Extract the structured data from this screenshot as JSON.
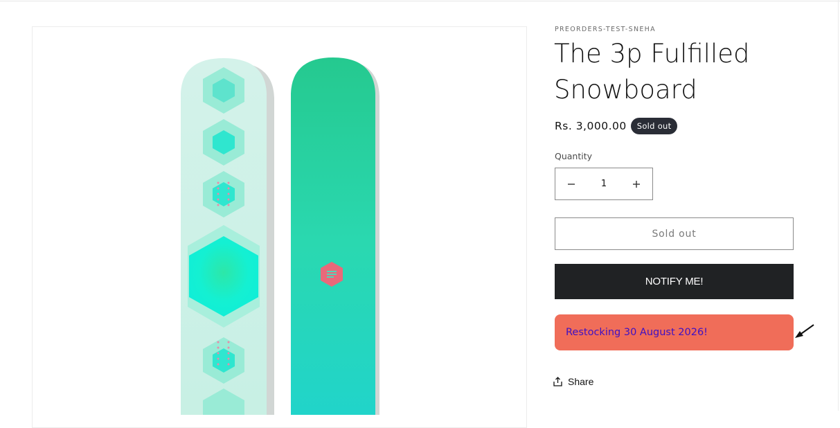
{
  "product": {
    "vendor": "PREORDERS-TEST-SNEHA",
    "title": "The 3p Fulfilled Snowboard",
    "price": "Rs. 3,000.00",
    "badge": "Sold out"
  },
  "quantity": {
    "label": "Quantity",
    "value": "1",
    "minus_icon": "minus-icon",
    "plus_icon": "plus-icon"
  },
  "buttons": {
    "sold_out": "Sold out",
    "notify": "NOTIFY ME!"
  },
  "restock_message": "Restocking 30 August 2026!",
  "share": {
    "label": "Share",
    "icon": "share-icon"
  },
  "colors": {
    "notify_bg": "#202224",
    "restock_bg": "#f06d59",
    "restock_text": "#3d10c4",
    "badge_bg": "#2a2d36"
  }
}
